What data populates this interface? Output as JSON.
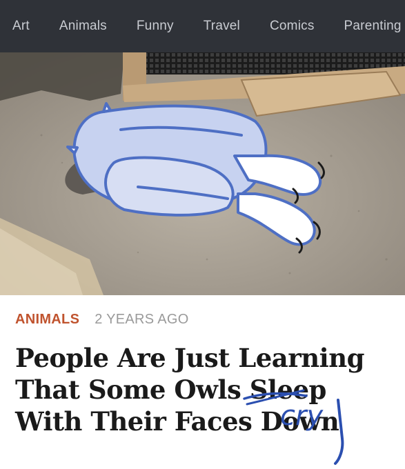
{
  "nav": {
    "items": [
      {
        "label": "Art"
      },
      {
        "label": "Animals"
      },
      {
        "label": "Funny"
      },
      {
        "label": "Travel"
      },
      {
        "label": "Comics"
      },
      {
        "label": "Parenting"
      }
    ]
  },
  "hero": {
    "icon": "owl-sleeping-face-down-photo"
  },
  "article": {
    "category": "ANIMALS",
    "age": "2 YEARS AGO",
    "headline_part1": "People Are Just Learning That Some Owls ",
    "headline_struck": "Sleep",
    "headline_part2": " With Their Faces Down",
    "handwritten_correction": "cry"
  },
  "colors": {
    "nav_bg": "#2f3238",
    "category": "#c0532e",
    "correction_ink": "#2b4fb0"
  }
}
